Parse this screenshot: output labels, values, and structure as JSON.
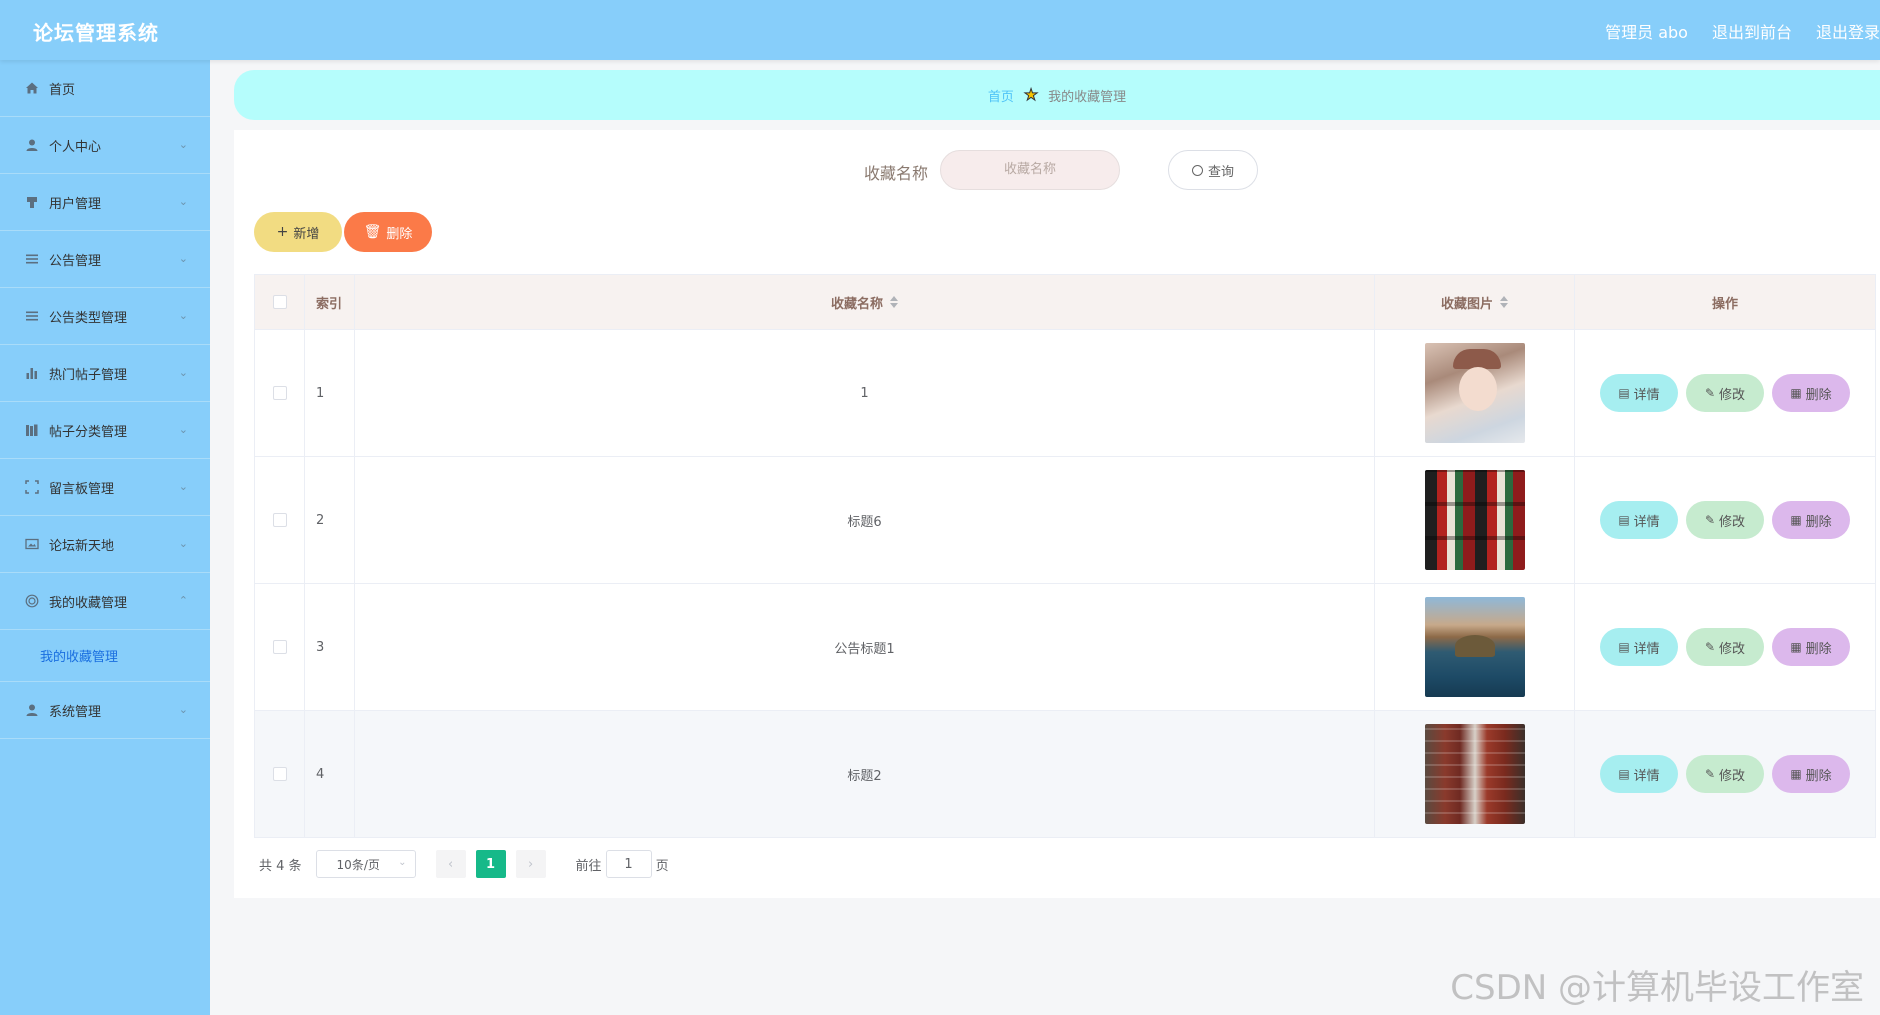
{
  "header": {
    "title": "论坛管理系统",
    "admin": "管理员 abo",
    "exit_front": "退出到前台",
    "logout": "退出登录"
  },
  "sidebar": {
    "items": [
      {
        "label": "首页",
        "icon": "home-icon",
        "has_arrow": false
      },
      {
        "label": "个人中心",
        "icon": "user-icon",
        "has_arrow": true
      },
      {
        "label": "用户管理",
        "icon": "users-icon",
        "has_arrow": true
      },
      {
        "label": "公告管理",
        "icon": "list-icon",
        "has_arrow": true
      },
      {
        "label": "公告类型管理",
        "icon": "list-icon",
        "has_arrow": true
      },
      {
        "label": "热门帖子管理",
        "icon": "bar-chart-icon",
        "has_arrow": true
      },
      {
        "label": "帖子分类管理",
        "icon": "books-icon",
        "has_arrow": true
      },
      {
        "label": "留言板管理",
        "icon": "frame-icon",
        "has_arrow": true
      },
      {
        "label": "论坛新天地",
        "icon": "image-icon",
        "has_arrow": true
      },
      {
        "label": "我的收藏管理",
        "icon": "target-icon",
        "has_arrow": true,
        "expanded": true
      },
      {
        "label": "系统管理",
        "icon": "user-icon",
        "has_arrow": true
      }
    ],
    "submenu_active": "我的收藏管理"
  },
  "breadcrumb": {
    "home": "首页",
    "current": "我的收藏管理"
  },
  "search": {
    "label": "收藏名称",
    "placeholder": "收藏名称",
    "button": "查询"
  },
  "actions": {
    "add": "新增",
    "delete": "删除"
  },
  "table": {
    "headers": {
      "index": "索引",
      "name": "收藏名称",
      "image": "收藏图片",
      "ops": "操作"
    },
    "rows": [
      {
        "index": "1",
        "name": "1",
        "image": "woman-portrait"
      },
      {
        "index": "2",
        "name": "标题6",
        "image": "certificates"
      },
      {
        "index": "3",
        "name": "公告标题1",
        "image": "lake-landscape"
      },
      {
        "index": "4",
        "name": "标题2",
        "image": "library-shelves"
      }
    ],
    "op_labels": {
      "detail": "详情",
      "edit": "修改",
      "delete": "删除"
    }
  },
  "pagination": {
    "total": "共 4 条",
    "page_size": "10条/页",
    "current_page": "1",
    "goto_label": "前往",
    "goto_value": "1",
    "page_suffix": "页"
  },
  "watermark": "CSDN @计算机毕设工作室",
  "colors": {
    "header_bg": "#87cefa",
    "breadcrumb_bg": "#b5fdfc",
    "active_page": "#16b989"
  }
}
